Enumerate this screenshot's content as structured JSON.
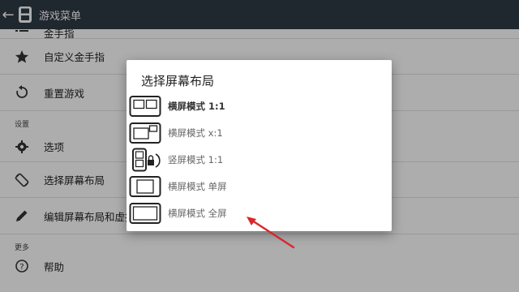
{
  "titlebar": {
    "title": "游戏菜单"
  },
  "menu": {
    "items_top": [
      {
        "label": "金手指",
        "icon": "list-icon"
      },
      {
        "label": "自定义金手指",
        "icon": "star-icon"
      },
      {
        "label": "重置游戏",
        "icon": "refresh-icon"
      }
    ],
    "section_settings": "设置",
    "items_settings": [
      {
        "label": "选项",
        "icon": "gear-icon"
      },
      {
        "label": "选择屏幕布局",
        "icon": "screen-rotation-icon"
      },
      {
        "label": "编辑屏幕布局和虚拟按键",
        "icon": "pencil-icon"
      }
    ],
    "section_more": "更多",
    "items_more": [
      {
        "label": "帮助",
        "icon": "help-icon"
      }
    ]
  },
  "dialog": {
    "title": "选择屏幕布局",
    "options": [
      {
        "label": "横屏模式 1:1",
        "icon": "layout-landscape-1-1-icon",
        "selected": true
      },
      {
        "label": "横屏模式 x:1",
        "icon": "layout-landscape-x-1-icon",
        "selected": false
      },
      {
        "label": "竖屏模式 1:1",
        "icon": "layout-portrait-lock-icon",
        "selected": false
      },
      {
        "label": "横屏模式 单屏",
        "icon": "layout-single-screen-icon",
        "selected": false
      },
      {
        "label": "横屏模式 全屏",
        "icon": "layout-fullscreen-icon",
        "selected": false
      }
    ]
  },
  "colors": {
    "titlebar": "#2e3a46",
    "scrim": "rgba(0,0,0,0.32)",
    "annotation_arrow": "#d9262c"
  }
}
